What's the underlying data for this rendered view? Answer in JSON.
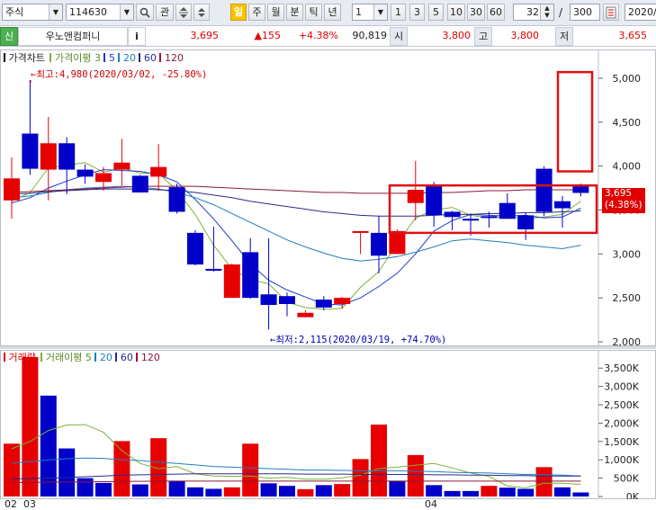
{
  "toolbar": {
    "market": "주식",
    "code": "114630",
    "search_icon": "magnifier-icon",
    "gwan": "관",
    "period_active": "일",
    "periods": [
      "주",
      "월",
      "분",
      "틱",
      "년"
    ],
    "interval_value": "1",
    "intervals": [
      "1",
      "3",
      "5",
      "10",
      "30",
      "60"
    ],
    "count_value": "32",
    "slash": "/",
    "max_count": "300",
    "date_value": "2020/"
  },
  "quote": {
    "badge": "신",
    "name": "우노앤컴퍼니",
    "info": "i",
    "price": "3,695",
    "change": "▲155",
    "pct": "+4.38%",
    "volume": "90,819",
    "open_label": "시",
    "open": "3,800",
    "high_label": "고",
    "high": "3,800",
    "low_label": "저",
    "low": "3,655"
  },
  "price_legend": {
    "title": "가격차트",
    "ma_title": "가격이평",
    "ma": [
      "3",
      "5",
      "20",
      "60",
      "120"
    ]
  },
  "volume_legend": {
    "title": "거래량",
    "ma_title": "거래이평",
    "ma": [
      "5",
      "20",
      "60",
      "120"
    ]
  },
  "annotations": {
    "high": "←최고:4,980(2020/03/02, -25.80%)",
    "low": "←최저:2,115(2020/03/19, +74.70%)",
    "current_price": "3,695",
    "current_pct": "(4.38%)"
  },
  "colors": {
    "up": "#e60000",
    "down": "#0000c8",
    "ma3": "#7db33a",
    "ma5": "#1a3ad0",
    "ma20": "#1f7fbf",
    "ma60": "#2a2a8a",
    "ma120": "#8b1a3a",
    "highlight": "#e01010"
  },
  "chart_data": [
    {
      "type": "candlestick",
      "title": "가격차트",
      "x_labels": [
        "02",
        "03",
        "04"
      ],
      "y_ticks": [
        2000,
        2500,
        3000,
        3500,
        4000,
        4500,
        5000
      ],
      "y_tick_labels": [
        "2,000",
        "2,500",
        "3,000",
        "3,500",
        "4,000",
        "4,500",
        "5,000"
      ],
      "ylim": [
        2000,
        5000
      ],
      "candles": [
        {
          "o": 3610,
          "h": 4100,
          "l": 3400,
          "c": 3860,
          "dir": "up"
        },
        {
          "o": 4370,
          "h": 4980,
          "l": 3900,
          "c": 3970,
          "dir": "down"
        },
        {
          "o": 3960,
          "h": 4560,
          "l": 3610,
          "c": 4260,
          "dir": "up"
        },
        {
          "o": 4260,
          "h": 4330,
          "l": 3680,
          "c": 3960,
          "dir": "down"
        },
        {
          "o": 3960,
          "h": 4020,
          "l": 3800,
          "c": 3880,
          "dir": "down"
        },
        {
          "o": 3820,
          "h": 3990,
          "l": 3720,
          "c": 3920,
          "dir": "up"
        },
        {
          "o": 3960,
          "h": 4310,
          "l": 3780,
          "c": 4040,
          "dir": "up"
        },
        {
          "o": 3890,
          "h": 3900,
          "l": 3700,
          "c": 3700,
          "dir": "down"
        },
        {
          "o": 3880,
          "h": 4250,
          "l": 3720,
          "c": 3990,
          "dir": "up"
        },
        {
          "o": 3760,
          "h": 3800,
          "l": 3460,
          "c": 3480,
          "dir": "down"
        },
        {
          "o": 3240,
          "h": 3270,
          "l": 2870,
          "c": 2880,
          "dir": "down"
        },
        {
          "o": 2830,
          "h": 3310,
          "l": 2800,
          "c": 2810,
          "dir": "down"
        },
        {
          "o": 2500,
          "h": 2890,
          "l": 2500,
          "c": 2880,
          "dir": "up"
        },
        {
          "o": 3020,
          "h": 3180,
          "l": 2490,
          "c": 2500,
          "dir": "down"
        },
        {
          "o": 2540,
          "h": 3180,
          "l": 2140,
          "c": 2420,
          "dir": "down"
        },
        {
          "o": 2520,
          "h": 2560,
          "l": 2290,
          "c": 2430,
          "dir": "down"
        },
        {
          "o": 2280,
          "h": 2360,
          "l": 2280,
          "c": 2330,
          "dir": "up"
        },
        {
          "o": 2480,
          "h": 2520,
          "l": 2360,
          "c": 2390,
          "dir": "down"
        },
        {
          "o": 2430,
          "h": 2510,
          "l": 2380,
          "c": 2500,
          "dir": "up"
        },
        {
          "o": 3260,
          "h": 3260,
          "l": 3000,
          "c": 3260,
          "dir": "up"
        },
        {
          "o": 3240,
          "h": 3430,
          "l": 2780,
          "c": 2980,
          "dir": "down"
        },
        {
          "o": 3000,
          "h": 3280,
          "l": 3000,
          "c": 3260,
          "dir": "up"
        },
        {
          "o": 3580,
          "h": 4060,
          "l": 3380,
          "c": 3730,
          "dir": "up"
        },
        {
          "o": 3770,
          "h": 3820,
          "l": 3310,
          "c": 3440,
          "dir": "down"
        },
        {
          "o": 3480,
          "h": 3490,
          "l": 3270,
          "c": 3420,
          "dir": "down"
        },
        {
          "o": 3400,
          "h": 3460,
          "l": 3210,
          "c": 3380,
          "dir": "down"
        },
        {
          "o": 3420,
          "h": 3480,
          "l": 3300,
          "c": 3430,
          "dir": "down"
        },
        {
          "o": 3580,
          "h": 3690,
          "l": 3400,
          "c": 3400,
          "dir": "down"
        },
        {
          "o": 3440,
          "h": 3470,
          "l": 3160,
          "c": 3280,
          "dir": "down"
        },
        {
          "o": 3970,
          "h": 4000,
          "l": 3430,
          "c": 3480,
          "dir": "down"
        },
        {
          "o": 3600,
          "h": 3660,
          "l": 3300,
          "c": 3520,
          "dir": "down"
        },
        {
          "o": 3770,
          "h": 3800,
          "l": 3655,
          "c": 3695,
          "dir": "down"
        }
      ],
      "ma_series": [
        {
          "name": "3",
          "values": [
            3600,
            3700,
            3980,
            4010,
            4040,
            3930,
            3980,
            3920,
            3920,
            3720,
            3450,
            3100,
            2830,
            2710,
            2660,
            2450,
            2390,
            2370,
            2380,
            2620,
            2800,
            3120,
            3410,
            3500,
            3530,
            3440,
            3410,
            3420,
            3400,
            3420,
            3450,
            3600
          ]
        },
        {
          "name": "5",
          "values": [
            3580,
            3640,
            3750,
            3830,
            3900,
            3960,
            3950,
            3940,
            3900,
            3820,
            3620,
            3400,
            3150,
            2890,
            2700,
            2590,
            2510,
            2430,
            2420,
            2500,
            2630,
            2780,
            3000,
            3260,
            3380,
            3450,
            3440,
            3430,
            3440,
            3410,
            3420,
            3520
          ]
        },
        {
          "name": "20",
          "values": [
            3640,
            3660,
            3700,
            3730,
            3750,
            3760,
            3770,
            3760,
            3740,
            3700,
            3640,
            3560,
            3460,
            3360,
            3260,
            3160,
            3080,
            3010,
            2950,
            2920,
            2940,
            2970,
            3020,
            3080,
            3150,
            3170,
            3150,
            3130,
            3100,
            3080,
            3060,
            3100
          ]
        },
        {
          "name": "60",
          "values": [
            3680,
            3690,
            3710,
            3720,
            3730,
            3740,
            3740,
            3740,
            3730,
            3720,
            3700,
            3670,
            3640,
            3600,
            3570,
            3540,
            3510,
            3480,
            3460,
            3440,
            3430,
            3430,
            3430,
            3440,
            3450,
            3450,
            3460,
            3460,
            3470,
            3470,
            3480,
            3490
          ]
        },
        {
          "name": "120",
          "values": [
            3700,
            3710,
            3720,
            3730,
            3740,
            3750,
            3760,
            3770,
            3770,
            3770,
            3770,
            3760,
            3750,
            3740,
            3730,
            3720,
            3710,
            3700,
            3700,
            3690,
            3690,
            3690,
            3690,
            3700,
            3700,
            3710,
            3720,
            3720,
            3730,
            3730,
            3730,
            3730
          ]
        }
      ]
    },
    {
      "type": "bar",
      "title": "거래량",
      "y_ticks": [
        0,
        500,
        1000,
        1500,
        2000,
        2500,
        3000,
        3500
      ],
      "y_tick_labels": [
        "0K",
        "500K",
        "1,000K",
        "1,500K",
        "2,000K",
        "2,500K",
        "3,000K",
        "3,500K"
      ],
      "ylim": [
        0,
        3800
      ],
      "values": [
        1440,
        3800,
        2750,
        1310,
        500,
        370,
        1510,
        330,
        1590,
        430,
        250,
        210,
        250,
        1440,
        360,
        290,
        200,
        310,
        340,
        1020,
        1960,
        430,
        1130,
        310,
        150,
        150,
        290,
        240,
        210,
        800,
        250,
        110
      ],
      "dirs": [
        "up",
        "up",
        "down",
        "down",
        "down",
        "down",
        "up",
        "down",
        "up",
        "down",
        "down",
        "down",
        "up",
        "up",
        "down",
        "down",
        "up",
        "down",
        "up",
        "up",
        "up",
        "down",
        "up",
        "down",
        "down",
        "down",
        "up",
        "down",
        "down",
        "up",
        "down",
        "down"
      ],
      "ma_series": [
        {
          "name": "5",
          "values": [
            1300,
            1500,
            1800,
            1950,
            1960,
            1750,
            1250,
            900,
            760,
            820,
            620,
            560,
            550,
            560,
            500,
            520,
            470,
            470,
            510,
            580,
            760,
            800,
            850,
            900,
            780,
            640,
            550,
            290,
            240,
            360,
            360,
            330
          ]
        },
        {
          "name": "20",
          "values": [
            900,
            950,
            1000,
            1030,
            1050,
            1040,
            1000,
            980,
            940,
            900,
            860,
            820,
            800,
            780,
            760,
            740,
            720,
            720,
            710,
            700,
            700,
            700,
            690,
            680,
            660,
            650,
            640,
            620,
            600,
            590,
            580,
            560
          ]
        },
        {
          "name": "60",
          "values": [
            480,
            490,
            500,
            520,
            540,
            560,
            580,
            590,
            600,
            610,
            620,
            620,
            620,
            620,
            620,
            620,
            610,
            610,
            610,
            600,
            600,
            600,
            600,
            590,
            590,
            580,
            580,
            570,
            570,
            560,
            560,
            560
          ]
        },
        {
          "name": "120",
          "values": [
            380,
            385,
            390,
            395,
            400,
            405,
            410,
            415,
            420,
            420,
            420,
            420,
            420,
            420,
            420,
            420,
            420,
            420,
            420,
            420,
            420,
            420,
            420,
            420,
            420,
            420,
            420,
            420,
            420,
            420,
            420,
            420
          ]
        }
      ]
    }
  ]
}
